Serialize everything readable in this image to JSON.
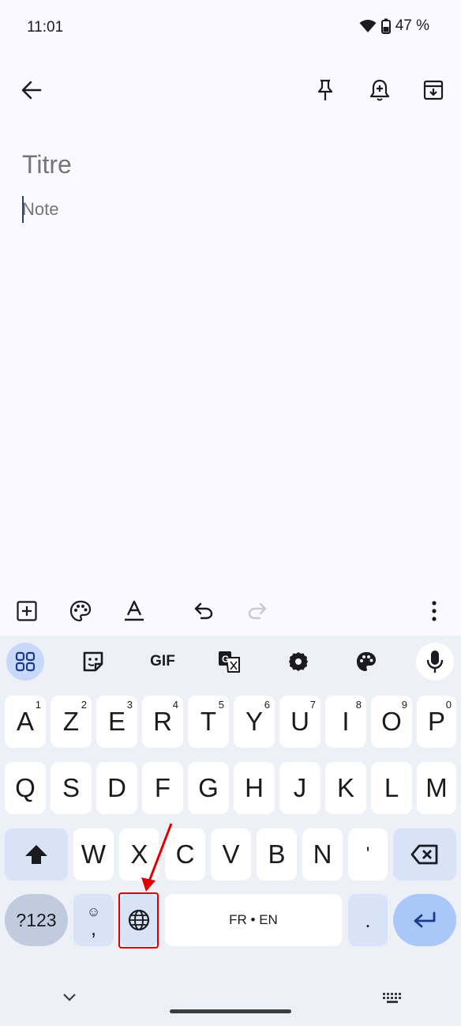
{
  "status_bar": {
    "time": "11:01",
    "battery": "47 %"
  },
  "app_bar": {
    "back_icon": "arrow-back-icon",
    "pin_icon": "pin-icon",
    "reminder_icon": "add-alert-icon",
    "archive_icon": "archive-icon"
  },
  "note": {
    "title_placeholder": "Titre",
    "body_placeholder": "Note"
  },
  "toolbar": {
    "add_icon": "add-box-icon",
    "palette_icon": "palette-icon",
    "format_icon": "text-format-icon",
    "undo_icon": "undo-icon",
    "redo_icon": "redo-icon",
    "more_icon": "more-vert-icon"
  },
  "keyboard": {
    "top_row": {
      "apps_icon": "grid-icon",
      "sticker_icon": "sticker-icon",
      "gif_label": "GIF",
      "translate_icon": "translate-icon",
      "settings_icon": "gear-icon",
      "theme_icon": "palette-icon",
      "mic_icon": "mic-icon"
    },
    "row1": [
      {
        "label": "A",
        "sup": "1"
      },
      {
        "label": "Z",
        "sup": "2"
      },
      {
        "label": "E",
        "sup": "3"
      },
      {
        "label": "R",
        "sup": "4"
      },
      {
        "label": "T",
        "sup": "5"
      },
      {
        "label": "Y",
        "sup": "6"
      },
      {
        "label": "U",
        "sup": "7"
      },
      {
        "label": "I",
        "sup": "8"
      },
      {
        "label": "O",
        "sup": "9"
      },
      {
        "label": "P",
        "sup": "0"
      }
    ],
    "row2": [
      "Q",
      "S",
      "D",
      "F",
      "G",
      "H",
      "J",
      "K",
      "L",
      "M"
    ],
    "row3": [
      "W",
      "X",
      "C",
      "V",
      "B",
      "N",
      "'"
    ],
    "symbols_label": "?123",
    "emoji_glyph": "☺",
    "comma_label": ",",
    "language_icon": "globe-icon",
    "space_label": "FR • EN",
    "period_label": ".",
    "enter_icon": "enter-icon",
    "shift_icon": "shift-icon",
    "backspace_icon": "backspace-icon"
  },
  "nav_bar": {
    "hide_keyboard_icon": "chevron-down-icon",
    "switch_keyboard_icon": "keyboard-icon"
  },
  "annotation": {
    "highlight_color": "#e00000"
  }
}
